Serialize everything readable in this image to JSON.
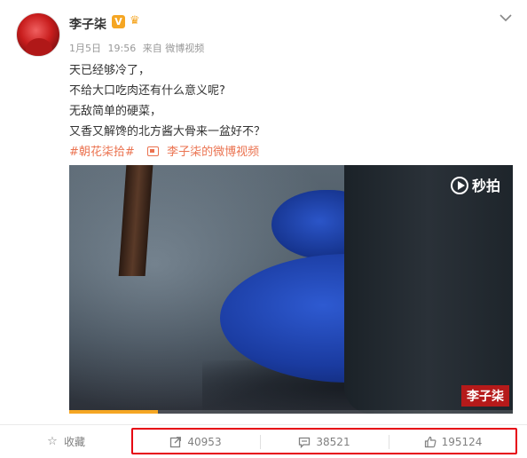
{
  "user": {
    "name": "李子柒",
    "verified_badge": "V"
  },
  "meta": {
    "date": "1月5日",
    "time": "19:56",
    "source": "来自 微博视频"
  },
  "post": {
    "lines": [
      "天已经够冷了，",
      "不给大口吃肉还有什么意义呢?",
      "无敌简单的硬菜，",
      "又香又解馋的北方酱大骨来一盆好不？"
    ],
    "hashtag": "#朝花柒拾#",
    "video_link": "李子柒的微博视频"
  },
  "video": {
    "brand": "秒拍",
    "watermark": "李子柒",
    "progress": 0.2
  },
  "actions": {
    "favorite": "收藏",
    "repost_count": "40953",
    "comment_count": "38521",
    "like_count": "195124"
  },
  "colors": {
    "accent": "#eb7350",
    "highlight": "#e60012",
    "badge": "#f5a623"
  }
}
